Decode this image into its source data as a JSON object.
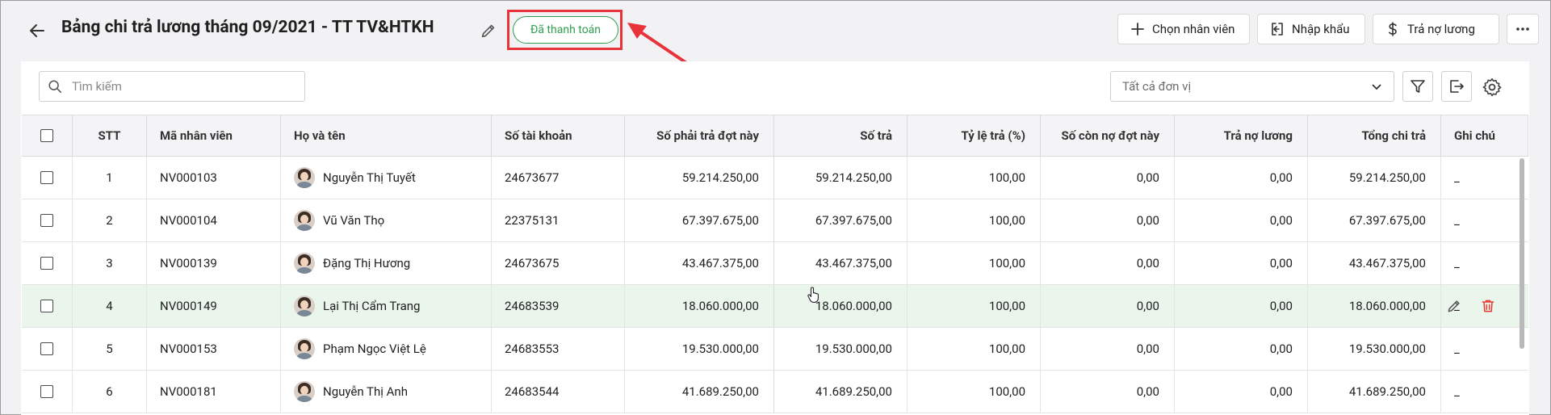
{
  "header": {
    "title": "Bảng chi trả lương tháng 09/2021 - TT TV&HTKH",
    "status_badge": "Đã thanh toán",
    "buttons": [
      {
        "label": "Chọn nhân viên",
        "icon": "plus-icon"
      },
      {
        "label": "Nhập khẩu",
        "icon": "import-icon"
      },
      {
        "label": "Trả nợ lương",
        "icon": "dollar-icon"
      }
    ],
    "more_icon": "more-icon"
  },
  "toolbar": {
    "search_placeholder": "Tìm kiếm",
    "unit_select": "Tất cả đơn vị"
  },
  "colors": {
    "accent_green": "#2e9e4f",
    "highlight_red": "#e8333a",
    "row_hover": "#eaf6ec",
    "delete_red": "#e53935"
  },
  "table": {
    "columns": [
      "STT",
      "Mã nhân viên",
      "Họ và tên",
      "Số tài khoản",
      "Số phải trả đợt này",
      "Số trả",
      "Tỷ lệ trả (%)",
      "Số còn nợ đợt này",
      "Trả nợ lương",
      "Tổng chi trả",
      "Ghi chú"
    ],
    "rows": [
      {
        "stt": "1",
        "code": "NV000103",
        "name": "Nguyễn Thị Tuyết",
        "account": "24673677",
        "due": "59.214.250,00",
        "paid": "59.214.250,00",
        "rate": "100,00",
        "remaining": "0,00",
        "debt_paid": "0,00",
        "total": "59.214.250,00",
        "note": "_"
      },
      {
        "stt": "2",
        "code": "NV000104",
        "name": "Vũ Văn Thọ",
        "account": "22375131",
        "due": "67.397.675,00",
        "paid": "67.397.675,00",
        "rate": "100,00",
        "remaining": "0,00",
        "debt_paid": "0,00",
        "total": "67.397.675,00",
        "note": "_"
      },
      {
        "stt": "3",
        "code": "NV000139",
        "name": "Đặng Thị Hương",
        "account": "24673675",
        "due": "43.467.375,00",
        "paid": "43.467.375,00",
        "rate": "100,00",
        "remaining": "0,00",
        "debt_paid": "0,00",
        "total": "43.467.375,00",
        "note": "_"
      },
      {
        "stt": "4",
        "code": "NV000149",
        "name": "Lại Thị Cẩm Trang",
        "account": "24683539",
        "due": "18.060.000,00",
        "paid": "18.060.000,00",
        "rate": "100,00",
        "remaining": "0,00",
        "debt_paid": "0,00",
        "total": "18.060.000,00",
        "note": "_"
      },
      {
        "stt": "5",
        "code": "NV000153",
        "name": "Phạm Ngọc Việt Lệ",
        "account": "24683553",
        "due": "19.530.000,00",
        "paid": "19.530.000,00",
        "rate": "100,00",
        "remaining": "0,00",
        "debt_paid": "0,00",
        "total": "19.530.000,00",
        "note": "_"
      },
      {
        "stt": "6",
        "code": "NV000181",
        "name": "Nguyễn Thị Anh",
        "account": "24683544",
        "due": "41.689.250,00",
        "paid": "41.689.250,00",
        "rate": "100,00",
        "remaining": "0,00",
        "debt_paid": "0,00",
        "total": "41.689.250,00",
        "note": "_"
      }
    ]
  }
}
